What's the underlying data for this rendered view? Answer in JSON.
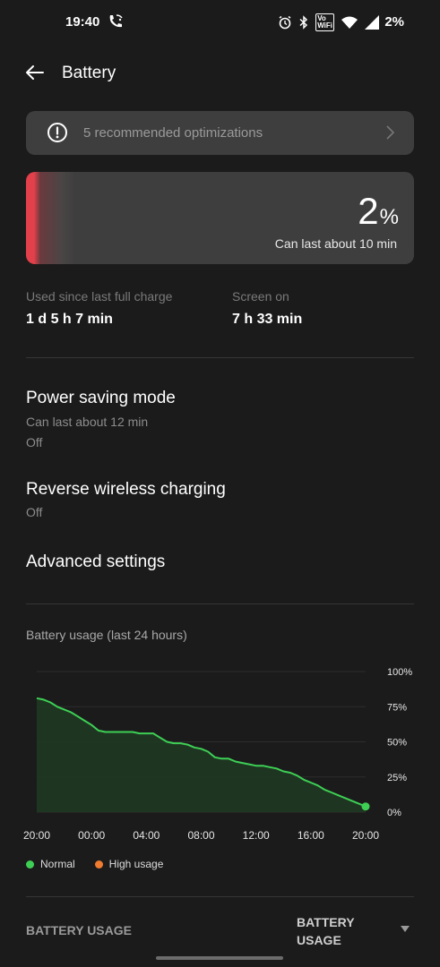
{
  "status_bar": {
    "time": "19:40",
    "battery": "2%",
    "icons": [
      "call-wifi-icon",
      "alarm-icon",
      "bluetooth-icon",
      "vowifi-icon",
      "wifi-icon",
      "signal-icon"
    ]
  },
  "header": {
    "title": "Battery"
  },
  "optimization": {
    "text": "5 recommended optimizations"
  },
  "battery_card": {
    "percent": "2",
    "percent_symbol": "%",
    "remaining": "Can last about 10 min",
    "level": 0.02,
    "accent": "#e2404a"
  },
  "stats": {
    "used_label": "Used since last full charge",
    "used_value": "1 d 5 h 7 min",
    "screen_label": "Screen on",
    "screen_value": "7 h 33 min"
  },
  "settings": {
    "power_saving": {
      "title": "Power saving mode",
      "sub1": "Can last about 12 min",
      "sub2": "Off"
    },
    "reverse_wireless": {
      "title": "Reverse wireless charging",
      "sub": "Off"
    },
    "advanced": {
      "title": "Advanced settings"
    }
  },
  "chart_data": {
    "type": "area",
    "title": "Battery usage (last 24 hours)",
    "x_tick_labels": [
      "20:00",
      "00:00",
      "04:00",
      "08:00",
      "12:00",
      "16:00",
      "20:00"
    ],
    "y_tick_labels": [
      "100%",
      "75%",
      "50%",
      "25%",
      "0%"
    ],
    "ylim": [
      0,
      100
    ],
    "xlim_hours": [
      0,
      24
    ],
    "grid": true,
    "series": [
      {
        "name": "Normal",
        "color": "#3ecf55",
        "x_hours": [
          0,
          0.4,
          0.8,
          1.2,
          1.8,
          2.4,
          3.0,
          3.6,
          4.0,
          4.6,
          5.2,
          5.8,
          6.4,
          7.0,
          7.6,
          8.0,
          8.6,
          9.2,
          10.0,
          10.6,
          11.2,
          11.8,
          12.6,
          13.2,
          14.0,
          14.6,
          15.2,
          15.8,
          16.4,
          17.0,
          17.6,
          18.2,
          18.8,
          19.4,
          20.0,
          20.6,
          21.2,
          21.8,
          22.4,
          23.0,
          23.5,
          24.0
        ],
        "values": [
          81,
          80,
          78,
          75,
          73,
          71,
          68,
          65,
          62,
          58,
          57,
          57,
          57,
          57,
          57,
          56,
          56,
          56,
          53,
          50,
          49,
          49,
          48,
          46,
          45,
          43,
          39,
          38,
          38,
          36,
          35,
          34,
          33,
          33,
          32,
          31,
          29,
          28,
          26,
          23,
          21,
          19,
          16,
          14,
          12,
          10,
          8,
          6,
          4
        ]
      }
    ],
    "legend": [
      {
        "label": "Normal",
        "color": "#3ecf55"
      },
      {
        "label": "High usage",
        "color": "#ee7b30"
      }
    ]
  },
  "bottom": {
    "left_label": "BATTERY USAGE",
    "right_label": "BATTERY USAGE"
  }
}
